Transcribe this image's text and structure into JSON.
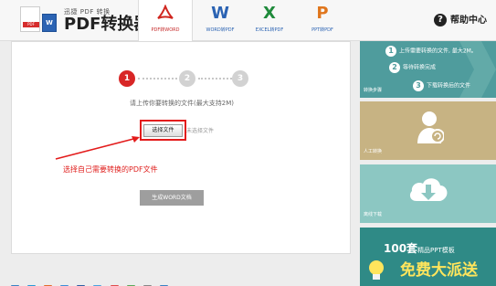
{
  "logo": {
    "tagline": "迅捷 PDF 转换",
    "name": "PDF转换器",
    "doc_tag": "PDF",
    "word_tag": "W"
  },
  "tabs": [
    {
      "glyph": "✓",
      "label": "PDF转WORD",
      "color": "#d0261f",
      "icon": "pdf-icon"
    },
    {
      "glyph": "W",
      "label": "WORD转PDF",
      "color": "#2b63b3",
      "icon": "word-icon"
    },
    {
      "glyph": "X",
      "label": "EXCEL转PDF",
      "color": "#1f8a3b",
      "icon": "excel-icon"
    },
    {
      "glyph": "P",
      "label": "PPT转PDF",
      "color": "#e0761d",
      "icon": "ppt-icon"
    }
  ],
  "help": {
    "icon": "?",
    "label": "帮助中心"
  },
  "steps": [
    "1",
    "2",
    "3"
  ],
  "upload": {
    "hint": "请上传你要转换的文件(最大支持2M)",
    "select_label": "选择文件",
    "no_file": "未选择文件",
    "annotation": "选择自己需要转换的PDF文件",
    "generate_label": "生成WORD文档"
  },
  "side": {
    "steps_panel": {
      "items": [
        {
          "num": "1",
          "text": "上传需要转换的文件, 最大2M。"
        },
        {
          "num": "2",
          "text": "等待转换完成"
        },
        {
          "num": "3",
          "text": "下载转换后的文件"
        }
      ],
      "caption": "转换步骤"
    },
    "manual": {
      "caption": "人工转换"
    },
    "download": {
      "caption": "离线下载"
    },
    "banner": {
      "count": "100套",
      "subtitle": "精品PPT模板",
      "slogan": "免费大派送"
    }
  },
  "colors": {
    "accent_red": "#d82626",
    "teal": "#4f9c9d",
    "tan": "#c7b383",
    "light_teal": "#8cc7c2",
    "banner": "#2f8a86"
  }
}
